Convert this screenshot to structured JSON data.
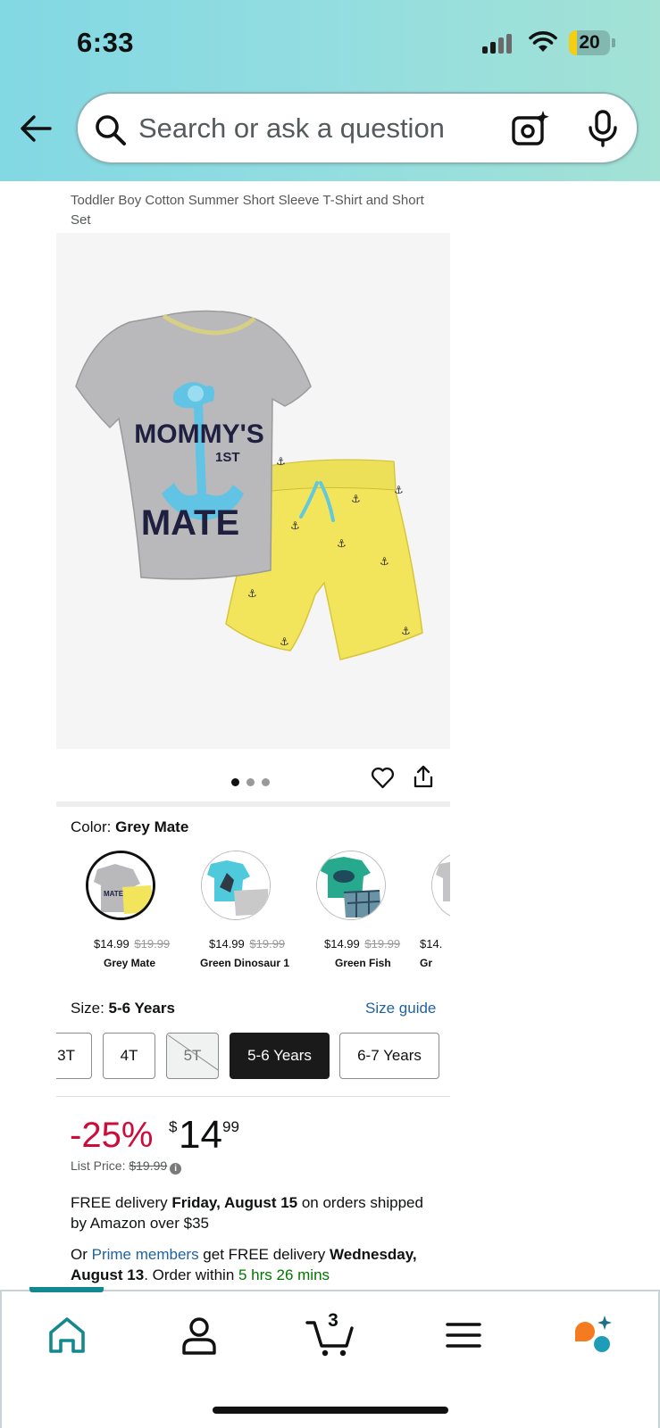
{
  "status_bar": {
    "time": "6:33",
    "battery": "20",
    "battery_level": 0.2
  },
  "search": {
    "placeholder": "Search or ask a question"
  },
  "product": {
    "title": "Toddler Boy Cotton Summer Short Sleeve T-Shirt and Short Set",
    "image": {
      "shirt_text_line1": "MOMMY'S",
      "shirt_text_line2": "1ST",
      "shirt_text_line3": "MATE"
    },
    "carousel": {
      "count": 3,
      "active_index": 0
    }
  },
  "color": {
    "label": "Color:",
    "selected": "Grey Mate",
    "options": [
      {
        "name": "Grey Mate",
        "price": "$14.99",
        "list_price": "$19.99",
        "selected": true
      },
      {
        "name": "Green Dinosaur 1",
        "price": "$14.99",
        "list_price": "$19.99",
        "selected": false
      },
      {
        "name": "Green Fish",
        "price": "$14.99",
        "list_price": "$19.99",
        "selected": false
      },
      {
        "name": "Gr",
        "price": "$14.",
        "list_price": "",
        "selected": false
      }
    ]
  },
  "size": {
    "label": "Size:",
    "selected": "5-6 Years",
    "guide_label": "Size guide",
    "options": [
      {
        "label": "3T",
        "state": "available"
      },
      {
        "label": "4T",
        "state": "available"
      },
      {
        "label": "5T",
        "state": "unavailable"
      },
      {
        "label": "5-6 Years",
        "state": "selected"
      },
      {
        "label": "6-7 Years",
        "state": "available"
      }
    ]
  },
  "pricing": {
    "discount": "-25%",
    "currency": "$",
    "whole": "14",
    "fraction": "99",
    "list_price_label": "List Price:",
    "list_price": "$19.99"
  },
  "delivery": {
    "line1_prefix": "FREE delivery ",
    "line1_date": "Friday, August 15",
    "line1_suffix": " on orders shipped by Amazon over $35",
    "line2_prefix": "Or ",
    "line2_link": "Prime members",
    "line2_middle": " get FREE delivery ",
    "line2_date": "Wednesday, August 13",
    "line2_order": ". Order within ",
    "line2_countdown": "5 hrs 26 mins"
  },
  "tabbar": {
    "cart_count": "3",
    "active_tab": "home"
  },
  "colors": {
    "accent": "#13888f",
    "link": "#2162a1",
    "discount": "#cc0c39",
    "rufus_orange": "#f47b20",
    "rufus_teal": "#1f9cb8"
  }
}
